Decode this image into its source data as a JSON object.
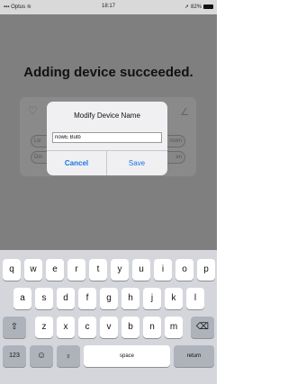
{
  "status_bar": {
    "carrier": "Optus",
    "time": "18:17",
    "battery": "82%"
  },
  "screen": {
    "headline": "Adding device succeeded.",
    "card": {
      "left_pills": [
        "Liv",
        "Din"
      ],
      "right_pills": [
        "room",
        "en"
      ]
    }
  },
  "dialog": {
    "title": "Modify Device Name",
    "input_value": "nowE Bulb",
    "cancel_label": "Cancel",
    "save_label": "Save"
  },
  "keyboard": {
    "row1": [
      "q",
      "w",
      "e",
      "r",
      "t",
      "y",
      "u",
      "i",
      "o",
      "p"
    ],
    "row2": [
      "a",
      "s",
      "d",
      "f",
      "g",
      "h",
      "j",
      "k",
      "l"
    ],
    "row3": [
      "z",
      "x",
      "c",
      "v",
      "b",
      "n",
      "m"
    ],
    "numbers_label": "123",
    "space_label": "space",
    "return_label": "return"
  },
  "icons": {
    "wifi": "wifi-icon",
    "location": "location-icon",
    "bulb": "bulb-icon",
    "edit": "pencil-icon",
    "shift": "shift-icon",
    "backspace": "backspace-icon",
    "emoji": "emoji-icon",
    "mic": "microphone-icon"
  }
}
